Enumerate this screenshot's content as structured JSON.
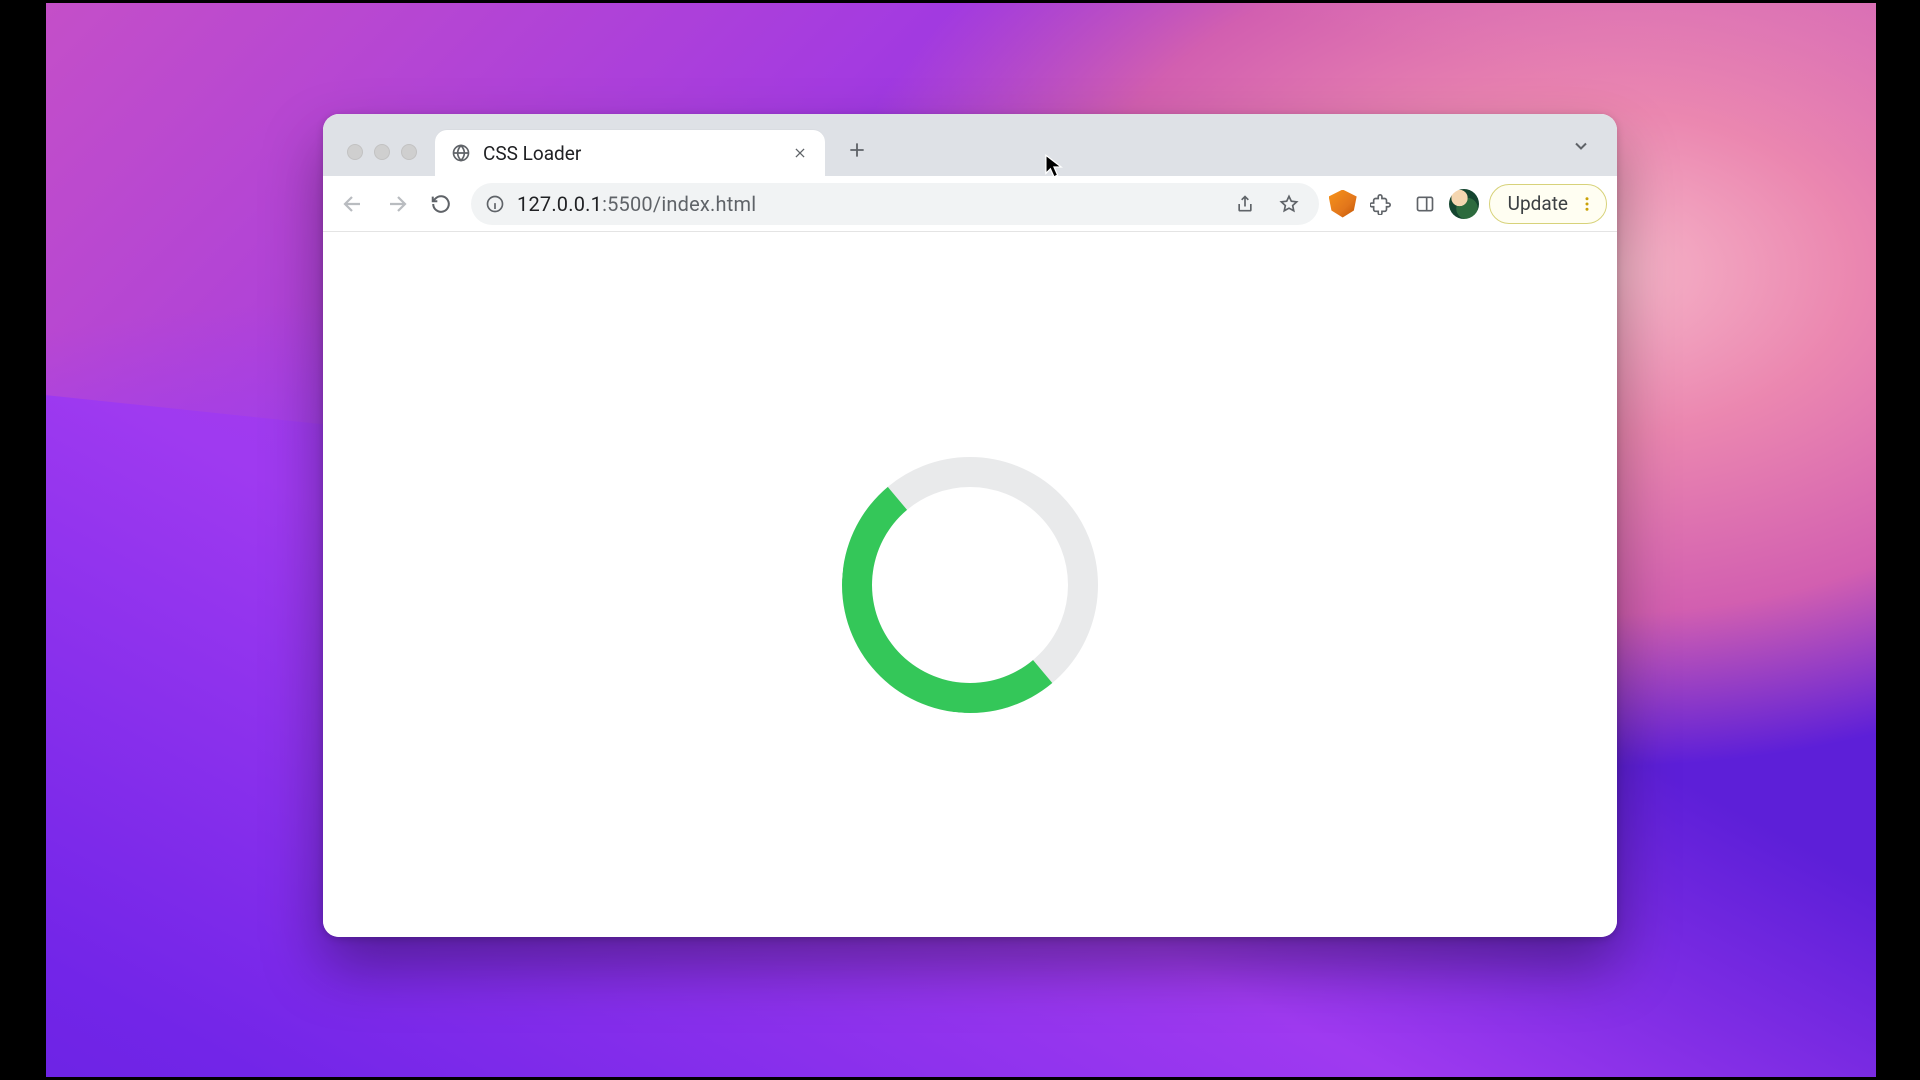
{
  "tab": {
    "title": "CSS Loader"
  },
  "address": {
    "host": "127.0.0.1",
    "rest": ":5500/index.html"
  },
  "update": {
    "label": "Update"
  },
  "spinner": {
    "track_color": "#e9eaeb",
    "accent_color": "#34c759"
  }
}
